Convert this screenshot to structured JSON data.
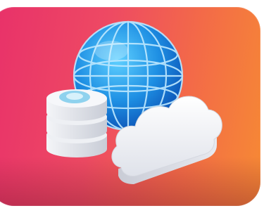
{
  "illustration": {
    "subject": "",
    "colors": {
      "tile_start": "#e8306a",
      "tile_end": "#f68a34",
      "globe": "#1e8fe3",
      "globe_grid": "#bfe9ff",
      "cloud": "#f4f5f8",
      "database": "#e6e8ee",
      "database_top": "#8fd2ee"
    }
  }
}
